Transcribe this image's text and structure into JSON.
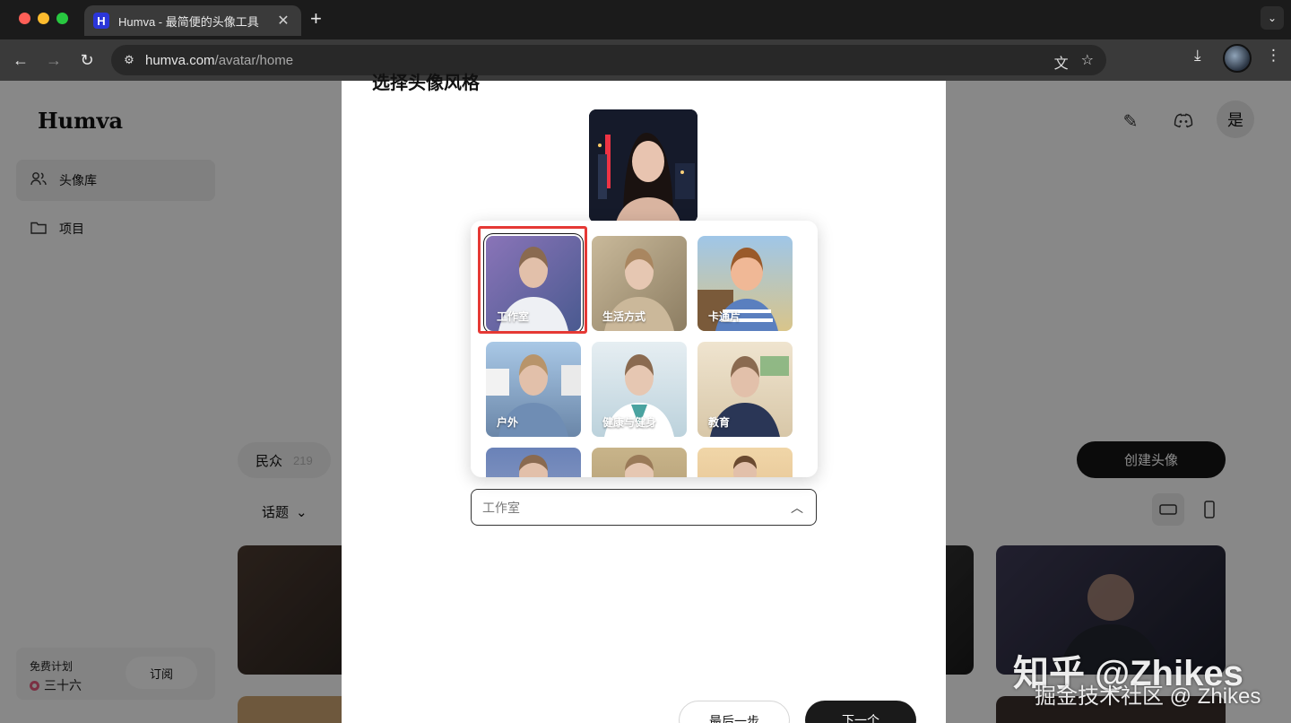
{
  "browser": {
    "tab_title": "Humva - 最简便的头像工具",
    "tab_favicon_letter": "H",
    "new_tab_icon": "+",
    "url_domain": "humva.com",
    "url_path": "/avatar/home"
  },
  "app": {
    "logo": "Humva",
    "sidebar": [
      {
        "label": "头像库",
        "icon": "users-icon",
        "active": true
      },
      {
        "label": "项目",
        "icon": "folder-icon",
        "active": false
      }
    ],
    "plan": {
      "title": "免费计划",
      "user": "三十六",
      "subscribe_label": "订阅"
    },
    "header_avatar_text": "是",
    "chip": {
      "label": "民众",
      "count": "219"
    },
    "topic_label": "话题",
    "create_button": "创建头像"
  },
  "modal": {
    "title": "选择头像风格",
    "styles": [
      {
        "label": "工作室",
        "selected": true
      },
      {
        "label": "生活方式",
        "selected": false
      },
      {
        "label": "卡通片",
        "selected": false
      },
      {
        "label": "户外",
        "selected": false
      },
      {
        "label": "健康与健身",
        "selected": false
      },
      {
        "label": "教育",
        "selected": false
      },
      {
        "label": "",
        "selected": false
      },
      {
        "label": "",
        "selected": false
      },
      {
        "label": "",
        "selected": false
      }
    ],
    "select_value": "工作室",
    "prev_button": "最后一步",
    "next_button": "下一个"
  },
  "watermark": {
    "line1": "知乎 @Zhikes",
    "line2": "掘金技术社区 @ Zhikes"
  }
}
